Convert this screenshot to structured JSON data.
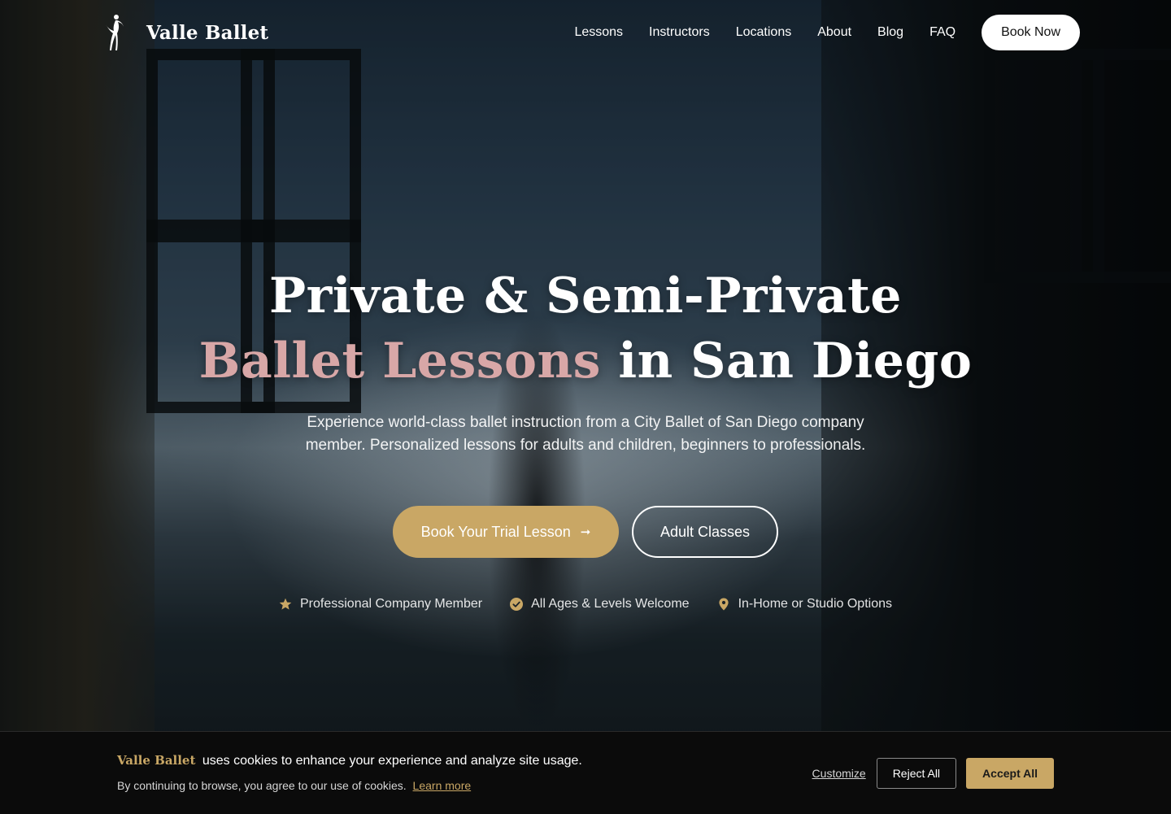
{
  "brand": {
    "name": "Valle Ballet",
    "logo_icon": "ballerina-icon"
  },
  "nav": {
    "items": [
      {
        "label": "Lessons"
      },
      {
        "label": "Instructors"
      },
      {
        "label": "Locations"
      },
      {
        "label": "About"
      },
      {
        "label": "Blog"
      },
      {
        "label": "FAQ"
      }
    ],
    "cta_label": "Book Now"
  },
  "hero": {
    "title_line1": "Private & Semi-Private",
    "title_accent": "Ballet Lessons",
    "title_rest": " in San Diego",
    "subtitle": "Experience world-class ballet instruction from a City Ballet of San Diego company member. Personalized lessons for adults and children, beginners to professionals.",
    "primary_cta": "Book Your Trial Lesson",
    "primary_cta_icon": "arrow-right-icon",
    "secondary_cta": "Adult Classes",
    "features": [
      {
        "icon": "star-icon",
        "label": "Professional Company Member"
      },
      {
        "icon": "check-circle-icon",
        "label": "All Ages & Levels Welcome"
      },
      {
        "icon": "map-pin-icon",
        "label": "In-Home or Studio Options"
      }
    ]
  },
  "cookie": {
    "brand": "Valle Ballet",
    "message": "uses cookies to enhance your experience and analyze site usage.",
    "subtext": "By continuing to browse, you agree to our use of cookies.",
    "learn_more": "Learn more",
    "customize": "Customize",
    "reject": "Reject All",
    "accept": "Accept All"
  },
  "colors": {
    "accent_gold": "#c9a765",
    "accent_rose": "#d8a7a7",
    "banner_bg": "#0b0b0b"
  }
}
